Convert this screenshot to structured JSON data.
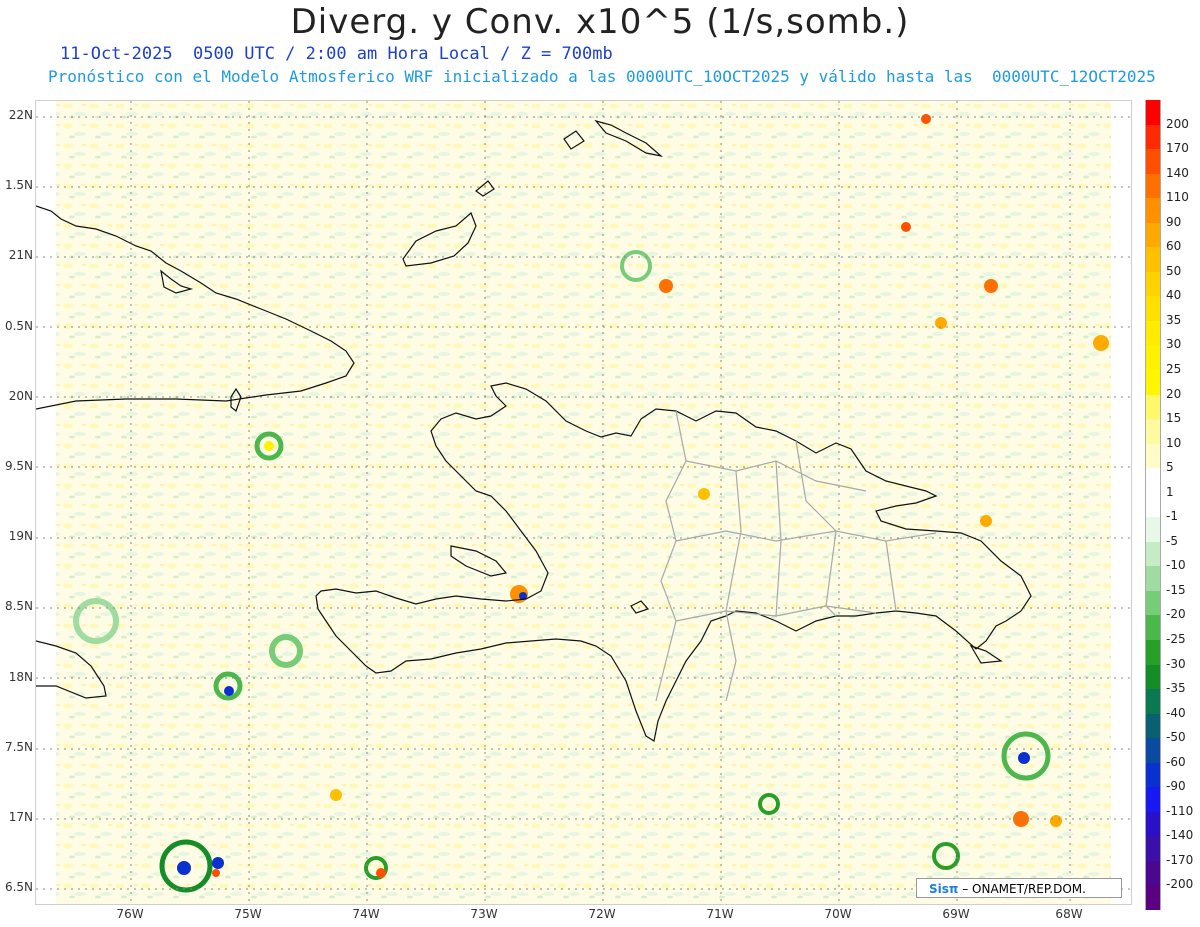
{
  "title": "Diverg. y Conv. x10^5 (1/s,somb.)",
  "subtitle1": "11-Oct-2025  0500 UTC / 2:00 am Hora Local / Z = 700mb",
  "subtitle2": "Pronóstico con el Modelo Atmosferico WRF inicializado a las 0000UTC_10OCT2025 y válido hasta las  0000UTC_12OCT2025",
  "y_ticks": [
    "22N",
    "1.5N",
    "21N",
    "0.5N",
    "20N",
    "9.5N",
    "19N",
    "8.5N",
    "18N",
    "7.5N",
    "17N",
    "6.5N"
  ],
  "x_ticks": [
    "76W",
    "75W",
    "74W",
    "73W",
    "72W",
    "71W",
    "70W",
    "69W",
    "68W"
  ],
  "colorbar": {
    "labels": [
      "200",
      "170",
      "140",
      "110",
      "90",
      "60",
      "50",
      "40",
      "35",
      "30",
      "25",
      "20",
      "15",
      "10",
      "5",
      "1",
      "-1",
      "-5",
      "-10",
      "-15",
      "-20",
      "-25",
      "-30",
      "-35",
      "-40",
      "-50",
      "-60",
      "-90",
      "-110",
      "-140",
      "-170",
      "-200"
    ],
    "colors": [
      "#ff0000",
      "#ff2a00",
      "#ff5000",
      "#ff7000",
      "#ff9000",
      "#ffaa00",
      "#ffc000",
      "#ffd200",
      "#ffe000",
      "#ffec00",
      "#fff200",
      "#fff600",
      "#fff86a",
      "#fffaa0",
      "#fffcc8",
      "#ffffff",
      "#ffffff",
      "#e8f8e8",
      "#c6ecc6",
      "#a0dca0",
      "#78cc78",
      "#4cb84c",
      "#28a028",
      "#148c28",
      "#0a7850",
      "#086070",
      "#0a4aa0",
      "#0a30d0",
      "#1818f0",
      "#2a10c8",
      "#3a10a8",
      "#4a0890",
      "#5a0080"
    ]
  },
  "credit": {
    "logo": "Sisπ",
    "text": "– ONAMET/REP.DOM."
  }
}
